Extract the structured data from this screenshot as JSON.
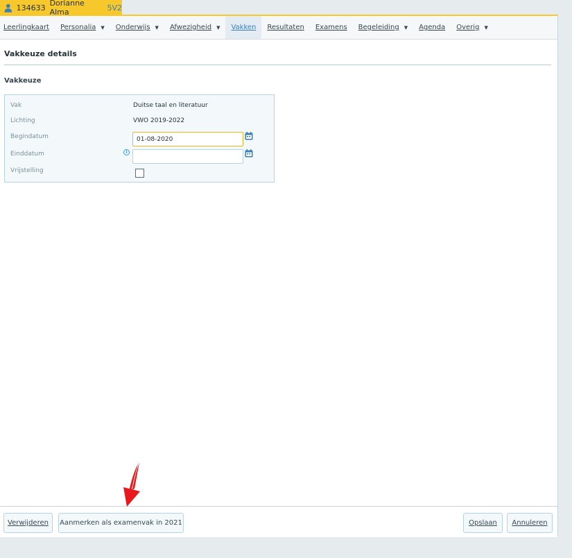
{
  "student": {
    "number": "134633",
    "name": "Dorianne Alma",
    "class": "5V2"
  },
  "nav": {
    "items": [
      {
        "label": "Leerlingkaart",
        "caret": false
      },
      {
        "label": "Personalia",
        "caret": true
      },
      {
        "label": "Onderwijs",
        "caret": true
      },
      {
        "label": "Afwezigheid",
        "caret": true
      },
      {
        "label": "Vakken",
        "caret": false,
        "active": true
      },
      {
        "label": "Resultaten",
        "caret": false
      },
      {
        "label": "Examens",
        "caret": false
      },
      {
        "label": "Begeleiding",
        "caret": true
      },
      {
        "label": "Agenda",
        "caret": false
      },
      {
        "label": "Overig",
        "caret": true
      }
    ]
  },
  "page": {
    "title": "Vakkeuze details",
    "section": "Vakkeuze"
  },
  "form": {
    "vak_label": "Vak",
    "vak_value": "Duitse taal en literatuur",
    "lichting_label": "Lichting",
    "lichting_value": "VWO 2019-2022",
    "begindatum_label": "Begindatum",
    "begindatum_value": "01-08-2020",
    "einddatum_label": "Einddatum",
    "einddatum_value": "",
    "vrijstelling_label": "Vrijstelling",
    "vrijstelling_checked": false
  },
  "footer": {
    "delete_label": "Verwijderen",
    "exam_label": "Aanmerken als examenvak in 2021",
    "save_label": "Opslaan",
    "cancel_label": "Annuleren"
  },
  "colors": {
    "accent": "#f7c82b",
    "link_blue": "#3d7fb8",
    "annotation_arrow": "#e8191c"
  },
  "icons": {
    "student": "person-icon",
    "calendar": "calendar-icon",
    "info": "info-icon",
    "caret": "caret-down-icon"
  }
}
